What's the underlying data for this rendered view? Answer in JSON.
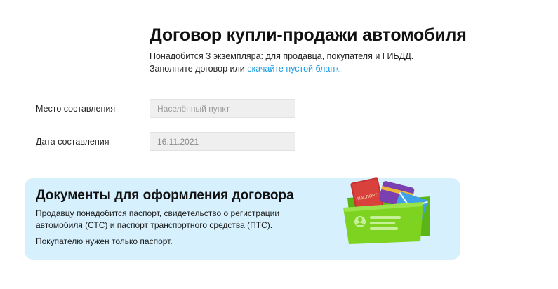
{
  "header": {
    "title": "Договор купли-продажи автомобиля",
    "line1": "Понадобится 3 экземпляра: для продавца, покупателя и ГИБДД.",
    "line2_prefix": "Заполните договор или ",
    "line2_link": "скачайте пустой бланк",
    "line2_suffix": "."
  },
  "form": {
    "place": {
      "label": "Место составления",
      "placeholder": "Населённый пункт",
      "value": ""
    },
    "date": {
      "label": "Дата составления",
      "value": "16.11.2021"
    }
  },
  "info_card": {
    "title": "Документы для оформления договора",
    "seller_text": "Продавцу понадобится паспорт, свидетельство о регистрации автомобиля (СТС) и паспорт транспортного средства (ПТС).",
    "buyer_text": "Покупателю нужен только паспорт.",
    "illustration": {
      "icon": "documents-folder-icon",
      "passport_label": "ПАСПОРТ"
    }
  },
  "colors": {
    "link": "#1a9be6",
    "card_background": "#d6f1fd",
    "input_background": "#efefef",
    "folder_green": "#7ed321",
    "passport_red": "#c8312f"
  }
}
